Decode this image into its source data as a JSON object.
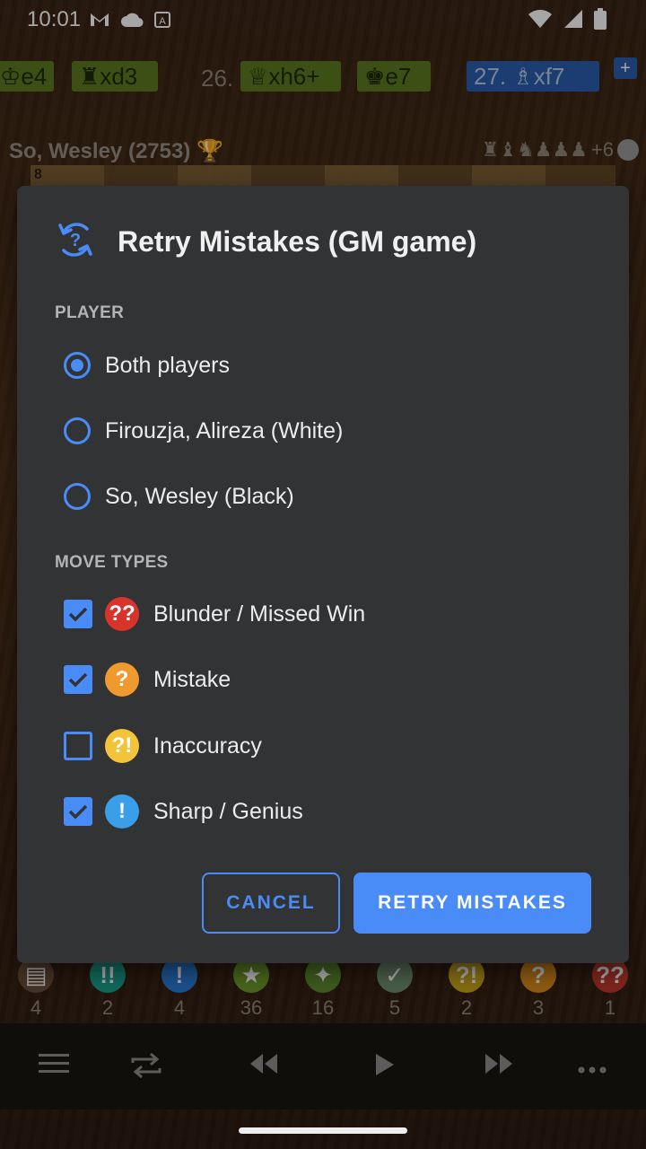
{
  "status_bar": {
    "time": "10:01"
  },
  "moves": {
    "chips": [
      {
        "text": "e4",
        "active": false
      },
      {
        "text": "xd3",
        "active": false
      },
      {
        "num": "26.",
        "text": "xh6+",
        "active": false
      },
      {
        "text": "e7",
        "active": false
      },
      {
        "num": "27.",
        "text": "xf7",
        "active": true
      }
    ]
  },
  "player": {
    "name": "So, Wesley (2753)",
    "advantage": "+6",
    "rank_label": "8"
  },
  "stats": [
    {
      "icon": "book-icon",
      "count": "4",
      "color": "#6b4f3a",
      "glyph": "▤"
    },
    {
      "icon": "brilliant-icon",
      "count": "2",
      "color": "#1aa08a",
      "glyph": "!!"
    },
    {
      "icon": "great-icon",
      "count": "4",
      "color": "#2b7bd6",
      "glyph": "!"
    },
    {
      "icon": "best-icon",
      "count": "36",
      "color": "#6d9a2a",
      "glyph": "★"
    },
    {
      "icon": "excellent-icon",
      "count": "16",
      "color": "#5c8a2e",
      "glyph": "✦"
    },
    {
      "icon": "good-icon",
      "count": "5",
      "color": "#6f8f6f",
      "glyph": "✓"
    },
    {
      "icon": "inaccuracy-icon",
      "count": "2",
      "color": "#c9a51d",
      "glyph": "?!"
    },
    {
      "icon": "mistake-icon",
      "count": "3",
      "color": "#d98a1c",
      "glyph": "?"
    },
    {
      "icon": "blunder-icon",
      "count": "1",
      "color": "#c0392b",
      "glyph": "??"
    }
  ],
  "dialog": {
    "title": "Retry Mistakes (GM game)",
    "player_section": "PLAYER",
    "players": [
      {
        "label": "Both players",
        "selected": true
      },
      {
        "label": "Firouzja, Alireza (White)",
        "selected": false
      },
      {
        "label": "So, Wesley (Black)",
        "selected": false
      }
    ],
    "move_section": "MOVE TYPES",
    "move_types": [
      {
        "label": "Blunder / Missed Win",
        "checked": true,
        "icon": "blunder-icon",
        "glyph": "??",
        "color": "#d9342b"
      },
      {
        "label": "Mistake",
        "checked": true,
        "icon": "mistake-icon",
        "glyph": "?",
        "color": "#ee9a2e"
      },
      {
        "label": "Inaccuracy",
        "checked": false,
        "icon": "inaccuracy-icon",
        "glyph": "?!",
        "color": "#f3c43a"
      },
      {
        "label": "Sharp / Genius",
        "checked": true,
        "icon": "sharp-icon",
        "glyph": "!",
        "color": "#3a9ee8"
      }
    ],
    "cancel_label": "CANCEL",
    "confirm_label": "RETRY MISTAKES"
  },
  "colors": {
    "accent": "#4a8cf7",
    "dialog_bg": "#323335"
  }
}
